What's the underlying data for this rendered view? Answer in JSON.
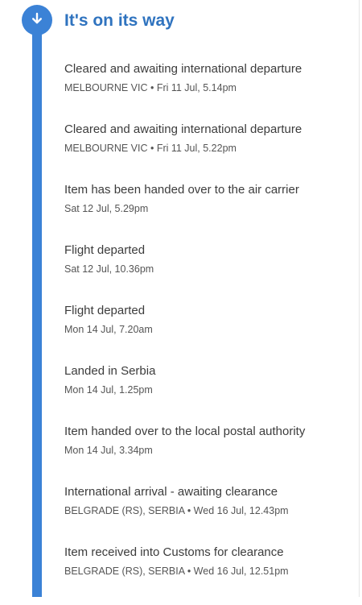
{
  "status": {
    "title": "It's on its way",
    "icon": "arrow-down-icon",
    "accent_color": "#3b82d6",
    "title_color": "#2f73bf"
  },
  "events": [
    {
      "title": "Cleared and awaiting international departure",
      "meta": "MELBOURNE VIC • Fri 11 Jul, 5.14pm"
    },
    {
      "title": "Cleared and awaiting international departure",
      "meta": "MELBOURNE VIC • Fri 11 Jul, 5.22pm"
    },
    {
      "title": "Item has been handed over to the air carrier",
      "meta": "Sat 12 Jul, 5.29pm"
    },
    {
      "title": "Flight departed",
      "meta": "Sat 12 Jul, 10.36pm"
    },
    {
      "title": "Flight departed",
      "meta": "Mon 14 Jul, 7.20am"
    },
    {
      "title": "Landed in Serbia",
      "meta": "Mon 14 Jul, 1.25pm"
    },
    {
      "title": "Item handed over to the local postal authority",
      "meta": "Mon 14 Jul, 3.34pm"
    },
    {
      "title": "International arrival - awaiting clearance",
      "meta": "BELGRADE (RS), SERBIA • Wed 16 Jul, 12.43pm"
    },
    {
      "title": "Item received into Customs for clearance",
      "meta": "BELGRADE (RS), SERBIA • Wed 16 Jul, 12.51pm"
    }
  ]
}
